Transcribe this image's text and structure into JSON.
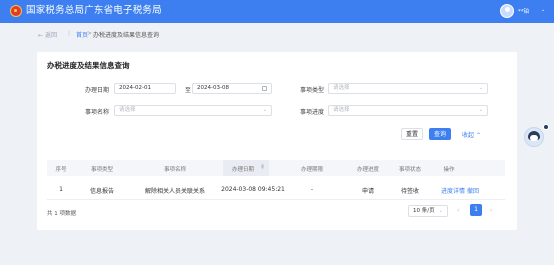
{
  "header": {
    "title": "国家税务总局广东省电子税务局",
    "user_name": "**铂"
  },
  "breadcrumb": {
    "back": "返回",
    "home": "首页",
    "separator": ">",
    "current": "办税进度及结果信息查询"
  },
  "form": {
    "title": "办税进度及结果信息查询",
    "date_label": "办理日期",
    "date_from": "2024-02-01",
    "date_to_sep": "至",
    "date_to": "2024-03-08",
    "matter_type_label": "事项类型",
    "matter_type_placeholder": "请选择",
    "matter_name_label": "事项名称",
    "matter_name_placeholder": "请选择",
    "matter_progress_label": "事项进度",
    "matter_progress_placeholder": "请选择",
    "reset_label": "重置",
    "query_label": "查询",
    "collapse_label": "收起"
  },
  "table": {
    "columns": [
      "序号",
      "事项类型",
      "事项名称",
      "办理日期",
      "办理期限",
      "办理进度",
      "事项状态",
      "操作"
    ],
    "rows": [
      {
        "index": "1",
        "type": "信息报告",
        "name": "解除相关人员关联关系",
        "date": "2024-03-08 09:45:21",
        "deadline": "-",
        "progress": "申请",
        "status": "待签收",
        "action_detail": "进度详情",
        "action_withdraw": "撤回"
      }
    ]
  },
  "pagination": {
    "total": "共 1 项数据",
    "page_size": "10 条/页",
    "current_page": "1"
  },
  "colors": {
    "primary": "#3d7ff0",
    "background": "#eef1f6"
  }
}
